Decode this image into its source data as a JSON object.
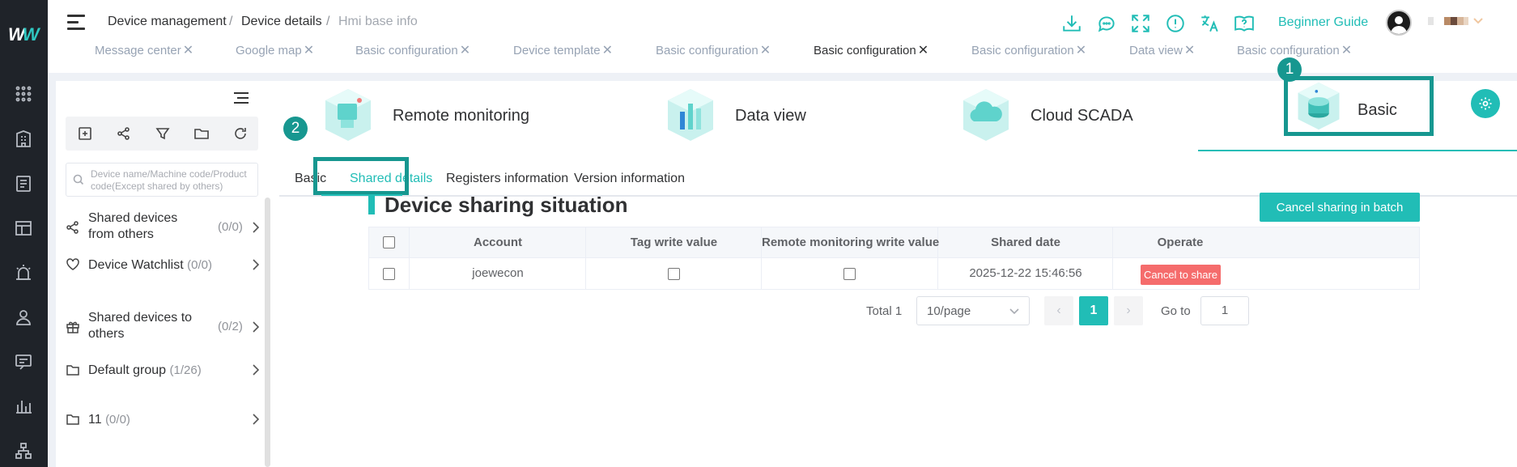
{
  "header": {
    "breadcrumb": [
      "Device management",
      "Device details",
      "Hmi base info"
    ],
    "beginner_guide": "Beginner Guide"
  },
  "tabs": [
    {
      "label": "Message center",
      "active": false
    },
    {
      "label": "Google map",
      "active": false
    },
    {
      "label": "Basic configuration",
      "active": false
    },
    {
      "label": "Device template",
      "active": false
    },
    {
      "label": "Basic configuration",
      "active": false
    },
    {
      "label": "Basic configuration",
      "active": true
    },
    {
      "label": "Basic configuration",
      "active": false
    },
    {
      "label": "Data view",
      "active": false
    },
    {
      "label": "Basic configuration",
      "active": false
    }
  ],
  "sidebar": {
    "search_placeholder": "Device name/Machine code/Product code(Except shared by others)",
    "items": [
      {
        "label": "Shared devices from others",
        "count": "(0/0)",
        "icon": "share-icon"
      },
      {
        "label": "Device Watchlist",
        "count": "(0/0)",
        "icon": "heart-icon"
      },
      {
        "label": "Shared devices to others",
        "count": "(0/2)",
        "icon": "gift-icon"
      },
      {
        "label": "Default group",
        "count": "(1/26)",
        "icon": "folder-icon"
      },
      {
        "label": "11",
        "count": "(0/0)",
        "icon": "folder-icon"
      }
    ]
  },
  "categories": [
    {
      "label": "Remote monitoring"
    },
    {
      "label": "Data view"
    },
    {
      "label": "Cloud SCADA"
    },
    {
      "label": "Basic"
    }
  ],
  "annotations": [
    "1",
    "2"
  ],
  "subtabs": [
    {
      "label": "Basic",
      "active": false
    },
    {
      "label": "Shared details",
      "active": true
    },
    {
      "label": "Registers information",
      "active": false
    },
    {
      "label": "Version information",
      "active": false
    }
  ],
  "section": {
    "title": "Device sharing situation",
    "batch_button": "Cancel sharing in batch"
  },
  "table": {
    "columns": [
      "Account",
      "Tag write value",
      "Remote monitoring write value",
      "Shared date",
      "Operate"
    ],
    "rows": [
      {
        "account": "joewecon",
        "shared_date": "2025-12-22 15:46:56",
        "operate": "Cancel to share"
      }
    ]
  },
  "pagination": {
    "total": "Total 1",
    "page_size": "10/page",
    "current_page": "1",
    "goto_label": "Go to",
    "goto_value": "1"
  },
  "colors": {
    "accent": "#21bdb6",
    "highlight": "#179790",
    "danger": "#f56c6c"
  }
}
